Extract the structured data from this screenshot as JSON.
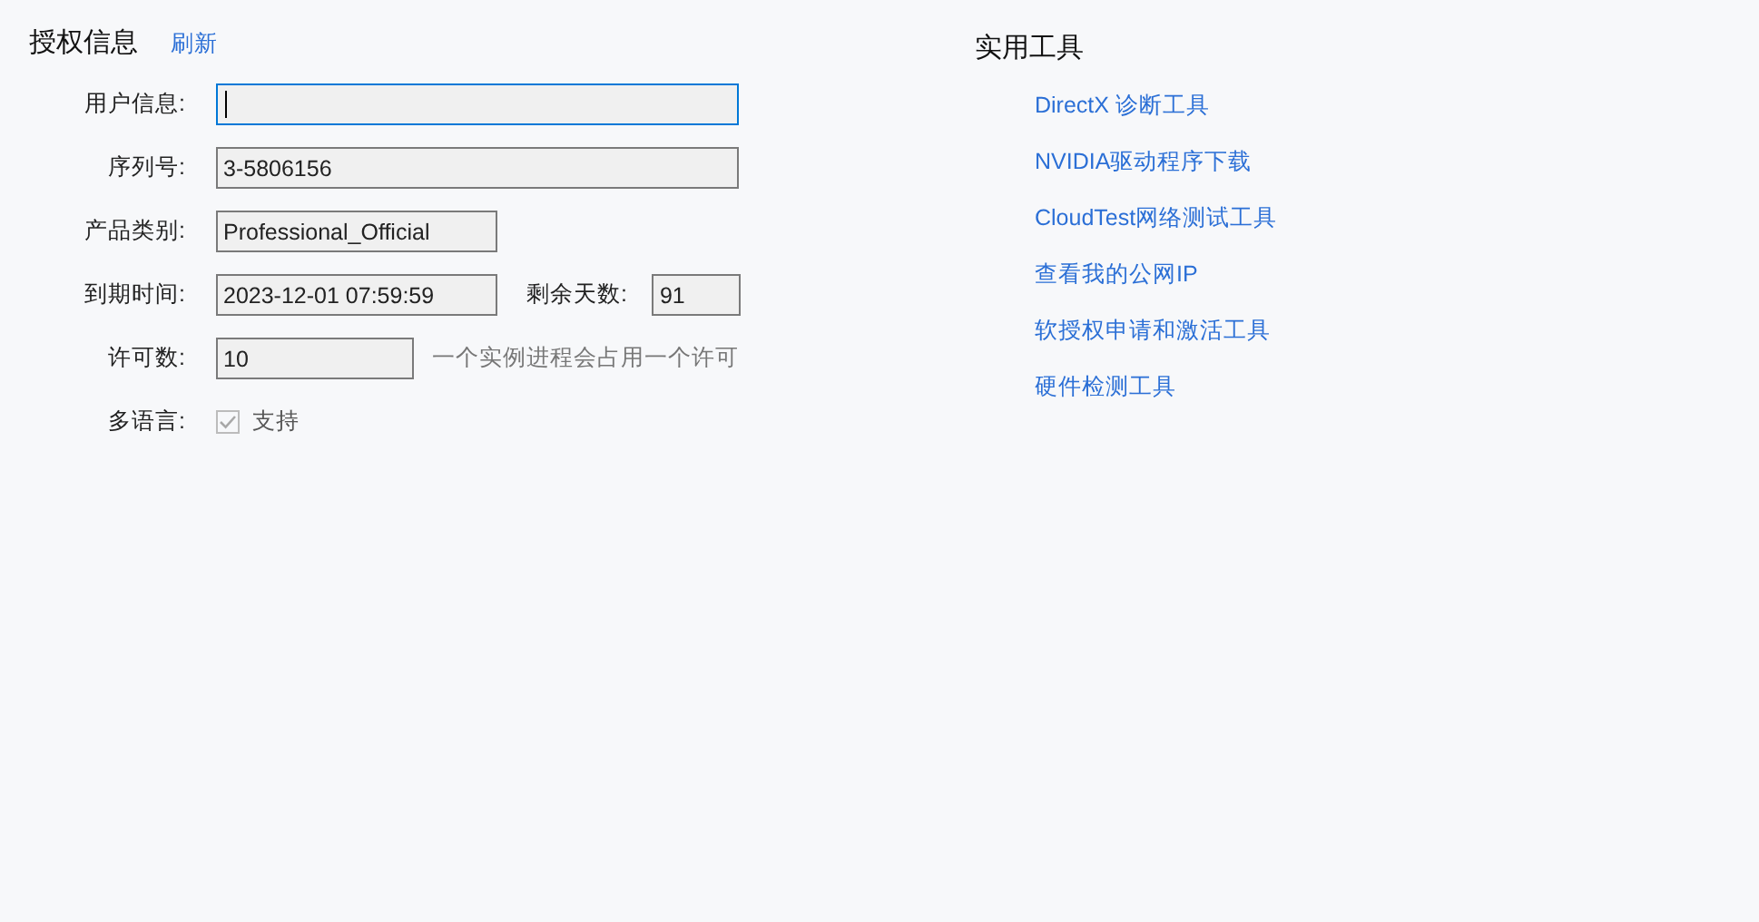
{
  "license": {
    "title": "授权信息",
    "refresh_link": "刷新",
    "rows": [
      {
        "kind": "field",
        "label": "用户信息:",
        "value": "",
        "focused": true
      },
      {
        "kind": "field",
        "label": "序列号:",
        "value": "3-5806156",
        "focused": false
      },
      {
        "kind": "field",
        "label": "产品类别:",
        "value": "Professional_Official",
        "focused": false
      },
      {
        "kind": "pair",
        "label": "到期时间:",
        "value": "2023-12-01 07:59:59",
        "focused": false,
        "label_2": "剩余天数:",
        "value_2": "91"
      },
      {
        "kind": "hint",
        "label": "许可数:",
        "value": "10",
        "focused": false,
        "hint": "一个实例进程会占用一个许可"
      },
      {
        "kind": "checkbox",
        "label": "多语言:",
        "checked": true,
        "disabled": true,
        "text": "支持"
      }
    ]
  },
  "tools": {
    "title": "实用工具",
    "links": [
      "DirectX 诊断工具",
      "NVIDIA驱动程序下载",
      "CloudTest网络测试工具",
      "查看我的公网IP",
      "软授权申请和激活工具",
      "硬件检测工具"
    ]
  }
}
